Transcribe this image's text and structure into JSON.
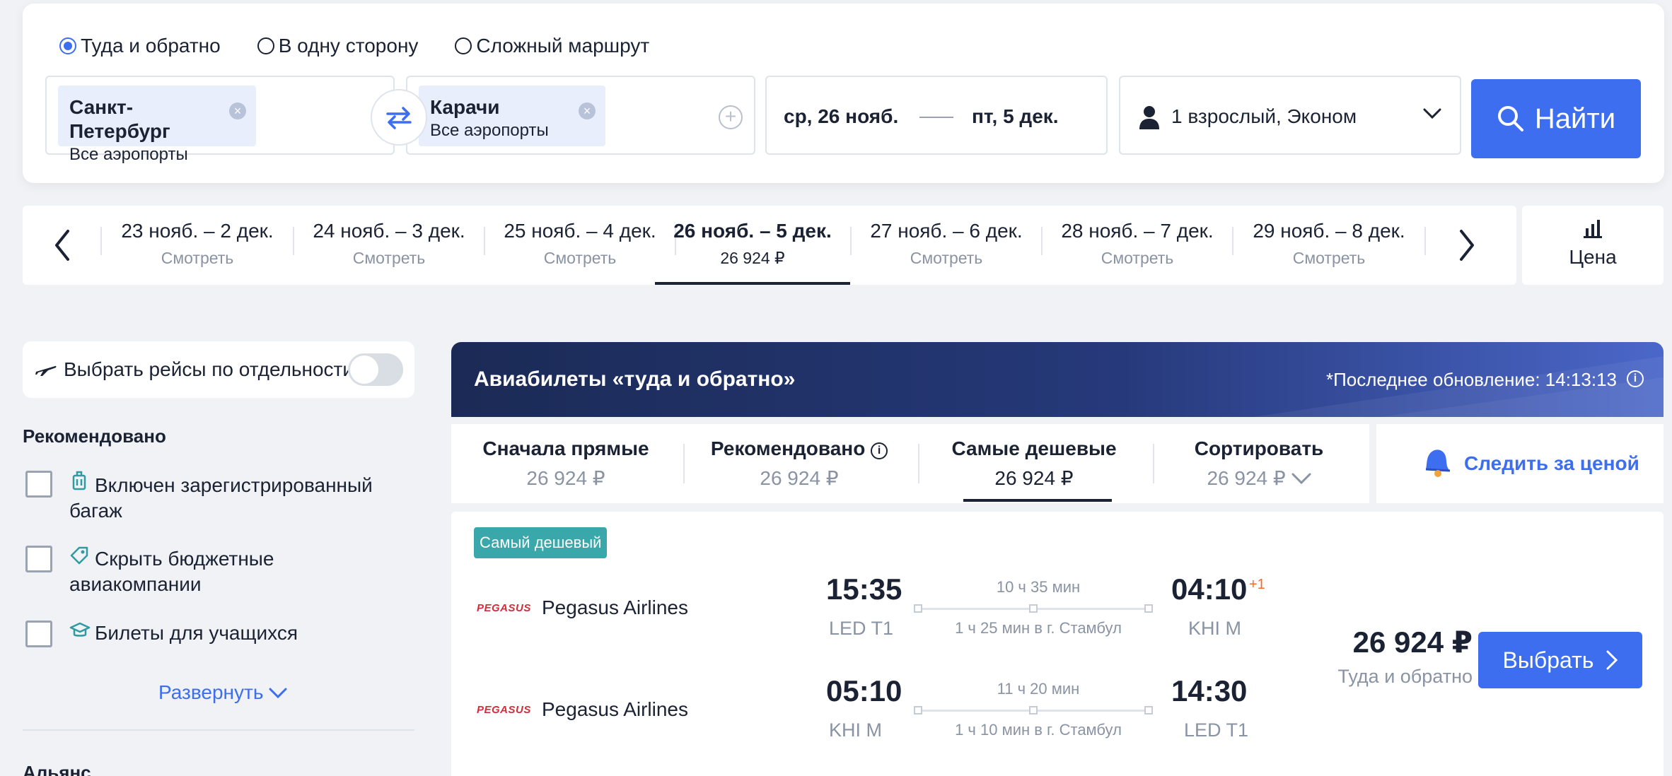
{
  "trip_types": [
    {
      "label": "Туда и обратно",
      "checked": true
    },
    {
      "label": "В одну сторону",
      "checked": false
    },
    {
      "label": "Сложный маршрут",
      "checked": false
    }
  ],
  "origin": {
    "city": "Санкт-Петербург",
    "airports": "Все аэропорты"
  },
  "destination": {
    "city": "Карачи",
    "airports": "Все аэропорты"
  },
  "dates": {
    "depart": "ср, 26 нояб.",
    "return": "пт, 5 дек."
  },
  "passengers": "1 взрослый, Эконом",
  "find_label": "Найти",
  "date_strip": [
    {
      "range": "23 нояб. – 2 дек.",
      "sub": "Смотреть"
    },
    {
      "range": "24 нояб. – 3 дек.",
      "sub": "Смотреть"
    },
    {
      "range": "25 нояб. – 4 дек.",
      "sub": "Смотреть"
    },
    {
      "range": "26 нояб. – 5 дек.",
      "sub": "26 924 ₽",
      "active": true
    },
    {
      "range": "27 нояб. – 6 дек.",
      "sub": "Смотреть"
    },
    {
      "range": "28 нояб. – 7 дек.",
      "sub": "Смотреть"
    },
    {
      "range": "29 нояб. – 8 дек.",
      "sub": "Смотреть"
    }
  ],
  "price_tab_label": "Цена",
  "sidebar": {
    "separate_label": "Выбрать рейсы по отдельности",
    "section_title": "Рекомендовано",
    "filters": [
      {
        "label": "Включен зарегистрированный багаж",
        "icon": "luggage-icon"
      },
      {
        "label": "Скрыть бюджетные авиакомпании",
        "icon": "tag-icon"
      },
      {
        "label": "Билеты для учащихся",
        "icon": "graduation-cap-icon"
      }
    ],
    "expand_label": "Развернуть",
    "next_section": "Альянс"
  },
  "banner": {
    "title": "Авиабилеты «туда и обратно»",
    "update": "*Последнее обновление: 14:13:13"
  },
  "sort_options": [
    {
      "label": "Сначала прямые",
      "price": "26 924 ₽"
    },
    {
      "label": "Рекомендовано",
      "price": "26 924 ₽"
    },
    {
      "label": "Самые дешевые",
      "price": "26 924 ₽",
      "active": true
    },
    {
      "label": "Сортировать",
      "price": "26 924 ₽"
    }
  ],
  "follow_price_label": "Следить за ценой",
  "ticket": {
    "badge": "Самый дешевый",
    "logo_text": "PEGASUS",
    "outbound": {
      "airline": "Pegasus Airlines",
      "dep_time": "15:35",
      "dep_airport": "LED T1",
      "duration": "10 ч 35 мин",
      "layover": "1 ч 25 мин в г. Стамбул",
      "arr_time": "04:10",
      "arr_airport": "KHI M",
      "plus_day": "+1"
    },
    "inbound": {
      "airline": "Pegasus Airlines",
      "dep_time": "05:10",
      "dep_airport": "KHI M",
      "duration": "11 ч 20 мин",
      "layover": "1 ч 10 мин в г. Стамбул",
      "arr_time": "14:30",
      "arr_airport": "LED T1"
    },
    "price": "26 924 ₽",
    "price_note": "Туда и обратно",
    "select_label": "Выбрать"
  },
  "colors": {
    "accent": "#3d6ef0",
    "badge": "#3aa7ab",
    "text": "#1a2233",
    "muted": "#8a93a3"
  }
}
